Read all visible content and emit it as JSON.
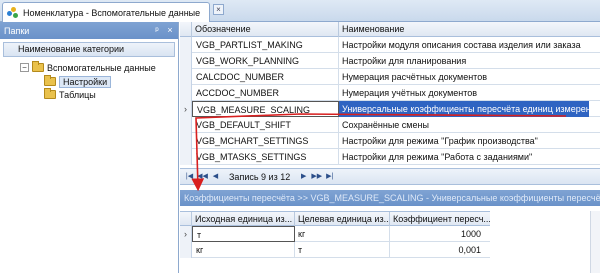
{
  "tab": {
    "title": "Номенклатура - Вспомогательные данные",
    "close": "×"
  },
  "left_panel": {
    "title": "Папки",
    "pin": "ᵖ",
    "close": "×",
    "column_header": "Наименование категории",
    "tree": [
      {
        "label": "Вспомогательные данные",
        "expander": "−"
      },
      {
        "label": "Настройки"
      },
      {
        "label": "Таблицы"
      }
    ]
  },
  "grid": {
    "columns": [
      "Обозначение",
      "Наименование"
    ],
    "rows": [
      {
        "code": "VGB_PARTLIST_MAKING",
        "name": "Настройки модуля описания состава изделия или заказа"
      },
      {
        "code": "VGB_WORK_PLANNING",
        "name": "Настройки для планирования"
      },
      {
        "code": "CALCDOC_NUMBER",
        "name": "Нумерация расчётных документов"
      },
      {
        "code": "ACCDOC_NUMBER",
        "name": "Нумерация учётных документов"
      },
      {
        "code": "VGB_MEASURE_SCALING",
        "name": "Универсальные коэффициенты пересчёта единиц измерения",
        "indicator": "›"
      },
      {
        "code": "VGB_DEFAULT_SHIFT",
        "name": "Сохранённые смены"
      },
      {
        "code": "VGB_MCHART_SETTINGS",
        "name": "Настройки для режима \"График производства\""
      },
      {
        "code": "VGB_MTASKS_SETTINGS",
        "name": "Настройки для режима \"Работа с заданиями\""
      }
    ]
  },
  "navigator": {
    "first": "|◀",
    "prev_page": "◀◀",
    "prev": "◀",
    "record_text": "Запись 9 из 12",
    "next": "▶",
    "next_page": "▶▶",
    "last": "▶|"
  },
  "detail": {
    "title": "Коэффициенты пересчёта >> VGB_MEASURE_SCALING - Универсальные коэффициенты пересчёта единиц измерения",
    "columns": [
      "Исходная единица из...",
      "Целевая единица из...",
      "Коэффициент пересч..."
    ],
    "rows": [
      {
        "src": "т",
        "dst": "кг",
        "factor": "1000",
        "indicator": "›"
      },
      {
        "src": "кг",
        "dst": "т",
        "factor": "0,001"
      }
    ]
  },
  "colors": {
    "selection": "#2f64c2",
    "annotation": "#d81f1f",
    "panel_header": "#6a92c9"
  }
}
